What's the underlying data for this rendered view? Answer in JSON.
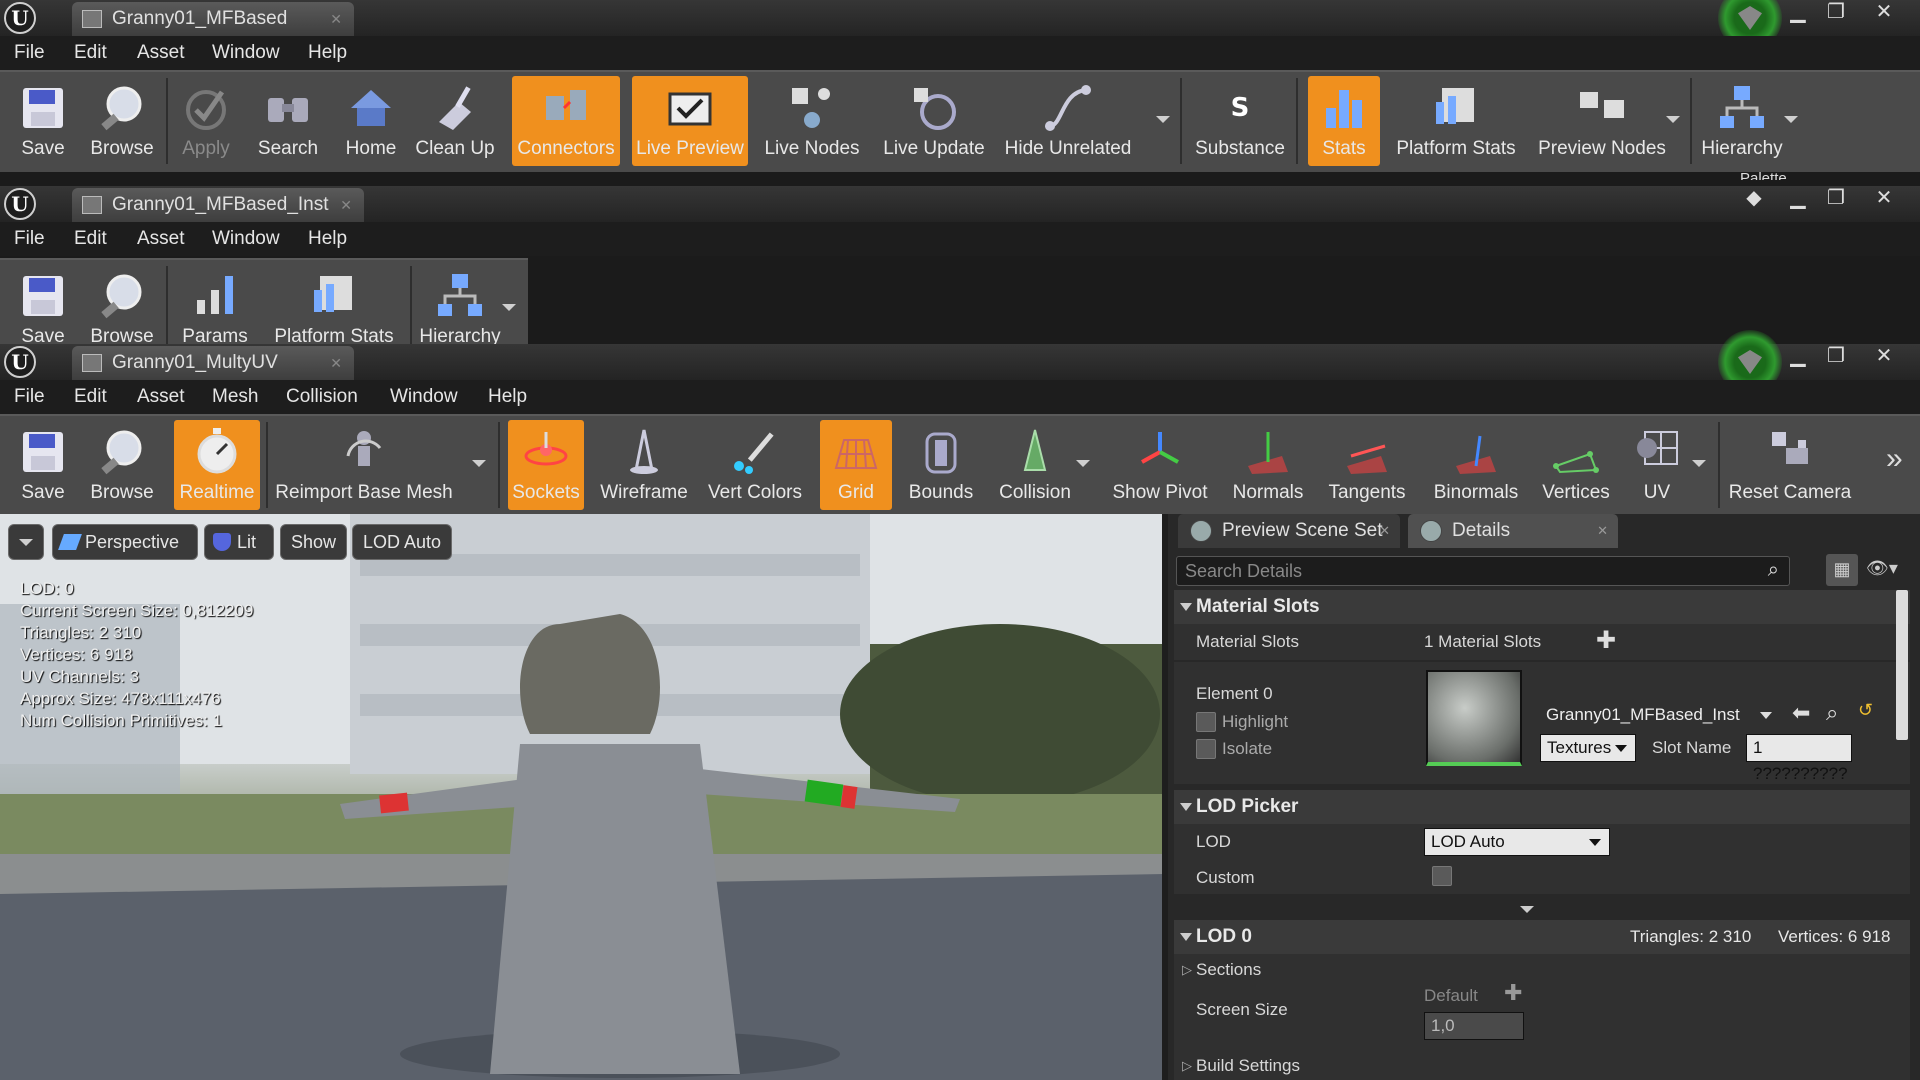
{
  "window1": {
    "tab_title": "Granny01_MFBased",
    "menu": [
      "File",
      "Edit",
      "Asset",
      "Window",
      "Help"
    ],
    "toolbar": [
      {
        "label": "Save",
        "icon": "save-icon"
      },
      {
        "label": "Browse",
        "icon": "browse-icon"
      },
      {
        "label": "Apply",
        "icon": "apply-icon",
        "disabled": true
      },
      {
        "label": "Search",
        "icon": "search-icon"
      },
      {
        "label": "Home",
        "icon": "home-icon"
      },
      {
        "label": "Clean Up",
        "icon": "clean-up-icon"
      },
      {
        "label": "Connectors",
        "icon": "connectors-icon",
        "active": true
      },
      {
        "label": "Live Preview",
        "icon": "live-preview-icon",
        "active": true
      },
      {
        "label": "Live Nodes",
        "icon": "live-nodes-icon"
      },
      {
        "label": "Live Update",
        "icon": "live-update-icon"
      },
      {
        "label": "Hide Unrelated",
        "icon": "hide-unrelated-icon"
      },
      {
        "label": "Substance",
        "icon": "substance-icon"
      },
      {
        "label": "Stats",
        "icon": "stats-icon",
        "active": true
      },
      {
        "label": "Platform Stats",
        "icon": "platform-stats-icon"
      },
      {
        "label": "Preview Nodes",
        "icon": "preview-nodes-icon"
      },
      {
        "label": "Hierarchy",
        "icon": "hierarchy-icon"
      }
    ],
    "palette_label": "Palette"
  },
  "window2": {
    "tab_title": "Granny01_MFBased_Inst",
    "menu": [
      "File",
      "Edit",
      "Asset",
      "Window",
      "Help"
    ],
    "toolbar": [
      {
        "label": "Save",
        "icon": "save-icon"
      },
      {
        "label": "Browse",
        "icon": "browse-icon"
      },
      {
        "label": "Params",
        "icon": "params-icon"
      },
      {
        "label": "Platform Stats",
        "icon": "platform-stats-icon"
      },
      {
        "label": "Hierarchy",
        "icon": "hierarchy-icon"
      }
    ]
  },
  "window3": {
    "tab_title": "Granny01_MultyUV",
    "menu": [
      "File",
      "Edit",
      "Asset",
      "Mesh",
      "Collision",
      "Window",
      "Help"
    ],
    "toolbar": [
      {
        "label": "Save",
        "icon": "save-icon"
      },
      {
        "label": "Browse",
        "icon": "browse-icon"
      },
      {
        "label": "Realtime",
        "icon": "realtime-icon",
        "active": true
      },
      {
        "label": "Reimport Base Mesh",
        "icon": "reimport-icon"
      },
      {
        "label": "Sockets",
        "icon": "sockets-icon",
        "active": true
      },
      {
        "label": "Wireframe",
        "icon": "wireframe-icon"
      },
      {
        "label": "Vert Colors",
        "icon": "vert-colors-icon"
      },
      {
        "label": "Grid",
        "icon": "grid-icon",
        "active": true
      },
      {
        "label": "Bounds",
        "icon": "bounds-icon"
      },
      {
        "label": "Collision",
        "icon": "collision-icon"
      },
      {
        "label": "Show Pivot",
        "icon": "show-pivot-icon"
      },
      {
        "label": "Normals",
        "icon": "normals-icon"
      },
      {
        "label": "Tangents",
        "icon": "tangents-icon"
      },
      {
        "label": "Binormals",
        "icon": "binormals-icon"
      },
      {
        "label": "Vertices",
        "icon": "vertices-icon"
      },
      {
        "label": "UV",
        "icon": "uv-icon"
      },
      {
        "label": "Reset Camera",
        "icon": "reset-camera-icon"
      }
    ]
  },
  "viewport": {
    "perspective": "Perspective",
    "lit": "Lit",
    "show": "Show",
    "lod": "LOD Auto",
    "stats": [
      "LOD:  0",
      "Current Screen Size:  0,812209",
      "Triangles:  2 310",
      "Vertices:  6 918",
      "UV Channels:  3",
      "Approx Size:  478x111x476",
      "Num Collision Primitives:  1"
    ]
  },
  "details": {
    "tab_preview": "Preview Scene Set",
    "tab_details": "Details",
    "search_placeholder": "Search Details",
    "material_slots": {
      "header": "Material Slots",
      "label": "Material Slots",
      "count": "1 Material Slots",
      "element": "Element 0",
      "highlight": "Highlight",
      "isolate": "Isolate",
      "material": "Granny01_MFBased_Inst",
      "textures": "Textures",
      "slot_name_label": "Slot Name",
      "slot_name": "1 ??????????"
    },
    "lod_picker": {
      "header": "LOD Picker",
      "lod_label": "LOD",
      "lod_value": "LOD Auto",
      "custom": "Custom"
    },
    "lod0": {
      "header": "LOD 0",
      "triangles": "Triangles: 2 310",
      "vertices": "Vertices: 6 918",
      "sections": "Sections",
      "default": "Default",
      "screen_size": "Screen Size",
      "screen_size_value": "1,0",
      "build_settings": "Build Settings"
    }
  },
  "colors": {
    "accent": "#f0901e",
    "toolbar": "#4a4a4a",
    "menubar": "#1d1d1d"
  }
}
